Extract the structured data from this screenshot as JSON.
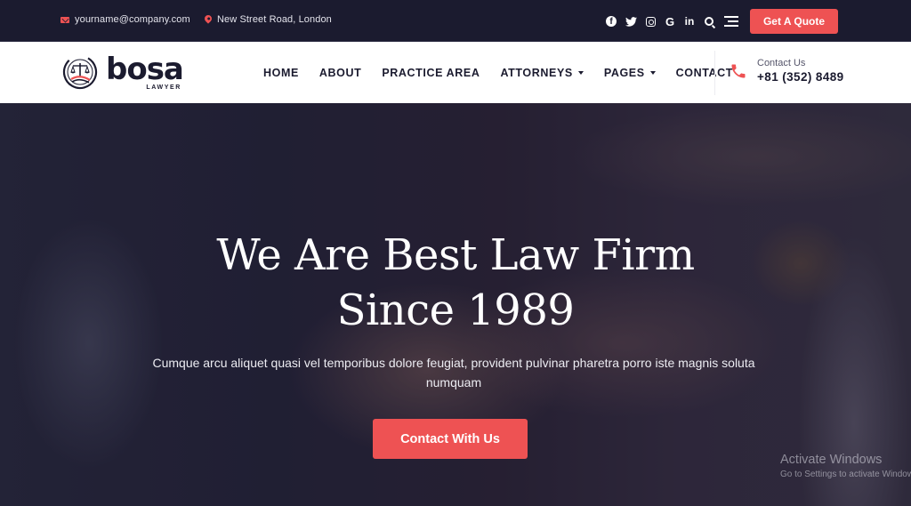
{
  "topbar": {
    "email": "yourname@company.com",
    "address": "New Street Road, London",
    "social_icons": [
      "facebook-icon",
      "twitter-icon",
      "instagram-icon",
      "google-icon",
      "linkedin-icon"
    ],
    "quote_button": "Get A Quote"
  },
  "header": {
    "logo": {
      "name": "bosa",
      "tagline": "LAWYER"
    },
    "nav": [
      {
        "label": "HOME",
        "has_dropdown": false
      },
      {
        "label": "ABOUT",
        "has_dropdown": false
      },
      {
        "label": "PRACTICE AREA",
        "has_dropdown": false
      },
      {
        "label": "ATTORNEYS",
        "has_dropdown": true
      },
      {
        "label": "PAGES",
        "has_dropdown": true
      },
      {
        "label": "CONTACT",
        "has_dropdown": false
      }
    ],
    "contact": {
      "label": "Contact Us",
      "phone": "+81 (352) 8489"
    }
  },
  "hero": {
    "title_line1": "We Are Best Law Firm",
    "title_line2": "Since 1989",
    "description": "Cumque arcu aliquet quasi vel temporibus dolore feugiat, provident pulvinar pharetra porro iste magnis soluta numquam",
    "cta": "Contact With Us"
  },
  "os_overlay": {
    "title": "Activate Windows",
    "subtitle": "Go to Settings to activate Windows."
  },
  "colors": {
    "accent": "#ee5253",
    "dark": "#1b1b2f",
    "white": "#ffffff"
  }
}
